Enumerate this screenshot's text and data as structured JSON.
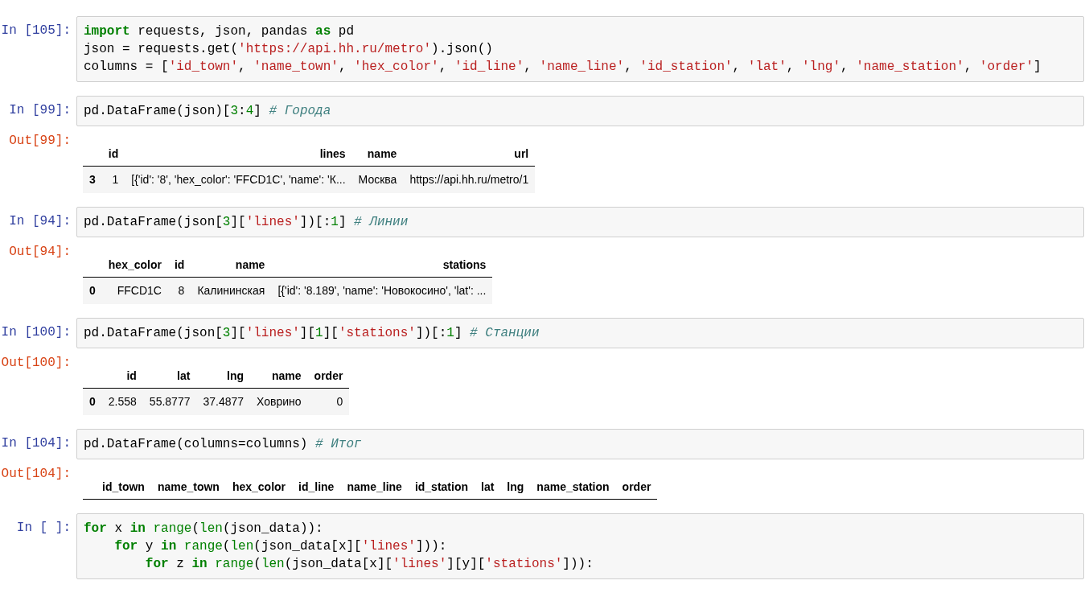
{
  "cells": [
    {
      "prompt": "In [105]:",
      "code": [
        [
          {
            "kind": "keyword",
            "text": "import"
          },
          {
            "kind": "plain",
            "text": " requests, json, pandas "
          },
          {
            "kind": "keyword",
            "text": "as"
          },
          {
            "kind": "plain",
            "text": " pd"
          }
        ],
        [
          {
            "kind": "plain",
            "text": "json = requests.get("
          },
          {
            "kind": "string",
            "text": "'https://api.hh.ru/metro'"
          },
          {
            "kind": "plain",
            "text": ").json()"
          }
        ],
        [
          {
            "kind": "plain",
            "text": "columns = ["
          },
          {
            "kind": "string",
            "text": "'id_town'"
          },
          {
            "kind": "plain",
            "text": ", "
          },
          {
            "kind": "string",
            "text": "'name_town'"
          },
          {
            "kind": "plain",
            "text": ", "
          },
          {
            "kind": "string",
            "text": "'hex_color'"
          },
          {
            "kind": "plain",
            "text": ", "
          },
          {
            "kind": "string",
            "text": "'id_line'"
          },
          {
            "kind": "plain",
            "text": ", "
          },
          {
            "kind": "string",
            "text": "'name_line'"
          },
          {
            "kind": "plain",
            "text": ", "
          },
          {
            "kind": "string",
            "text": "'id_station'"
          },
          {
            "kind": "plain",
            "text": ", "
          },
          {
            "kind": "string",
            "text": "'lat'"
          },
          {
            "kind": "plain",
            "text": ", "
          },
          {
            "kind": "string",
            "text": "'lng'"
          },
          {
            "kind": "plain",
            "text": ", "
          },
          {
            "kind": "string",
            "text": "'name_station'"
          },
          {
            "kind": "plain",
            "text": ", "
          },
          {
            "kind": "string",
            "text": "'order'"
          },
          {
            "kind": "plain",
            "text": "]"
          }
        ]
      ]
    },
    {
      "prompt": "In [99]:",
      "code": [
        [
          {
            "kind": "plain",
            "text": "pd.DataFrame(json)["
          },
          {
            "kind": "number",
            "text": "3"
          },
          {
            "kind": "plain",
            "text": ":"
          },
          {
            "kind": "number",
            "text": "4"
          },
          {
            "kind": "plain",
            "text": "] "
          },
          {
            "kind": "comment",
            "text": "# Города"
          }
        ]
      ],
      "output": {
        "prompt": "Out[99]:",
        "columns": [
          "id",
          "lines",
          "name",
          "url"
        ],
        "rows": [
          {
            "index": "3",
            "cells": [
              "1",
              "[{'id': '8', 'hex_color': 'FFCD1C', 'name': 'К...",
              "Москва",
              "https://api.hh.ru/metro/1"
            ]
          }
        ]
      }
    },
    {
      "prompt": "In [94]:",
      "code": [
        [
          {
            "kind": "plain",
            "text": "pd.DataFrame(json["
          },
          {
            "kind": "number",
            "text": "3"
          },
          {
            "kind": "plain",
            "text": "]["
          },
          {
            "kind": "string",
            "text": "'lines'"
          },
          {
            "kind": "plain",
            "text": "])[:"
          },
          {
            "kind": "number",
            "text": "1"
          },
          {
            "kind": "plain",
            "text": "] "
          },
          {
            "kind": "comment",
            "text": "# Линии"
          }
        ]
      ],
      "output": {
        "prompt": "Out[94]:",
        "columns": [
          "hex_color",
          "id",
          "name",
          "stations"
        ],
        "rows": [
          {
            "index": "0",
            "cells": [
              "FFCD1C",
              "8",
              "Калининская",
              "[{'id': '8.189', 'name': 'Новокосино', 'lat': ..."
            ]
          }
        ]
      }
    },
    {
      "prompt": "In [100]:",
      "code": [
        [
          {
            "kind": "plain",
            "text": "pd.DataFrame(json["
          },
          {
            "kind": "number",
            "text": "3"
          },
          {
            "kind": "plain",
            "text": "]["
          },
          {
            "kind": "string",
            "text": "'lines'"
          },
          {
            "kind": "plain",
            "text": "]["
          },
          {
            "kind": "number",
            "text": "1"
          },
          {
            "kind": "plain",
            "text": "]["
          },
          {
            "kind": "string",
            "text": "'stations'"
          },
          {
            "kind": "plain",
            "text": "])[:"
          },
          {
            "kind": "number",
            "text": "1"
          },
          {
            "kind": "plain",
            "text": "] "
          },
          {
            "kind": "comment",
            "text": "# Станции"
          }
        ]
      ],
      "output": {
        "prompt": "Out[100]:",
        "columns": [
          "id",
          "lat",
          "lng",
          "name",
          "order"
        ],
        "rows": [
          {
            "index": "0",
            "cells": [
              "2.558",
              "55.8777",
              "37.4877",
              "Ховрино",
              "0"
            ]
          }
        ]
      }
    },
    {
      "prompt": "In [104]:",
      "code": [
        [
          {
            "kind": "plain",
            "text": "pd.DataFrame(columns=columns) "
          },
          {
            "kind": "comment",
            "text": "# Итог"
          }
        ]
      ],
      "output": {
        "prompt": "Out[104]:",
        "columns": [
          "id_town",
          "name_town",
          "hex_color",
          "id_line",
          "name_line",
          "id_station",
          "lat",
          "lng",
          "name_station",
          "order"
        ]
      }
    },
    {
      "prompt": "In [ ]:",
      "code": [
        [
          {
            "kind": "keyword",
            "text": "for"
          },
          {
            "kind": "plain",
            "text": " x "
          },
          {
            "kind": "keyword",
            "text": "in "
          },
          {
            "kind": "builtin",
            "text": "range"
          },
          {
            "kind": "plain",
            "text": "("
          },
          {
            "kind": "builtin",
            "text": "len"
          },
          {
            "kind": "plain",
            "text": "(json_data)):"
          }
        ],
        [
          {
            "kind": "keyword",
            "text": "    for"
          },
          {
            "kind": "plain",
            "text": " y "
          },
          {
            "kind": "keyword",
            "text": "in "
          },
          {
            "kind": "builtin",
            "text": "range"
          },
          {
            "kind": "plain",
            "text": "("
          },
          {
            "kind": "builtin",
            "text": "len"
          },
          {
            "kind": "plain",
            "text": "(json_data[x]["
          },
          {
            "kind": "string",
            "text": "'lines'"
          },
          {
            "kind": "plain",
            "text": "])):"
          }
        ],
        [
          {
            "kind": "keyword",
            "text": "        for"
          },
          {
            "kind": "plain",
            "text": " z "
          },
          {
            "kind": "keyword",
            "text": "in "
          },
          {
            "kind": "builtin",
            "text": "range"
          },
          {
            "kind": "plain",
            "text": "("
          },
          {
            "kind": "builtin",
            "text": "len"
          },
          {
            "kind": "plain",
            "text": "(json_data[x]["
          },
          {
            "kind": "string",
            "text": "'lines'"
          },
          {
            "kind": "plain",
            "text": "][y]["
          },
          {
            "kind": "string",
            "text": "'stations'"
          },
          {
            "kind": "plain",
            "text": "])):"
          }
        ]
      ]
    }
  ]
}
